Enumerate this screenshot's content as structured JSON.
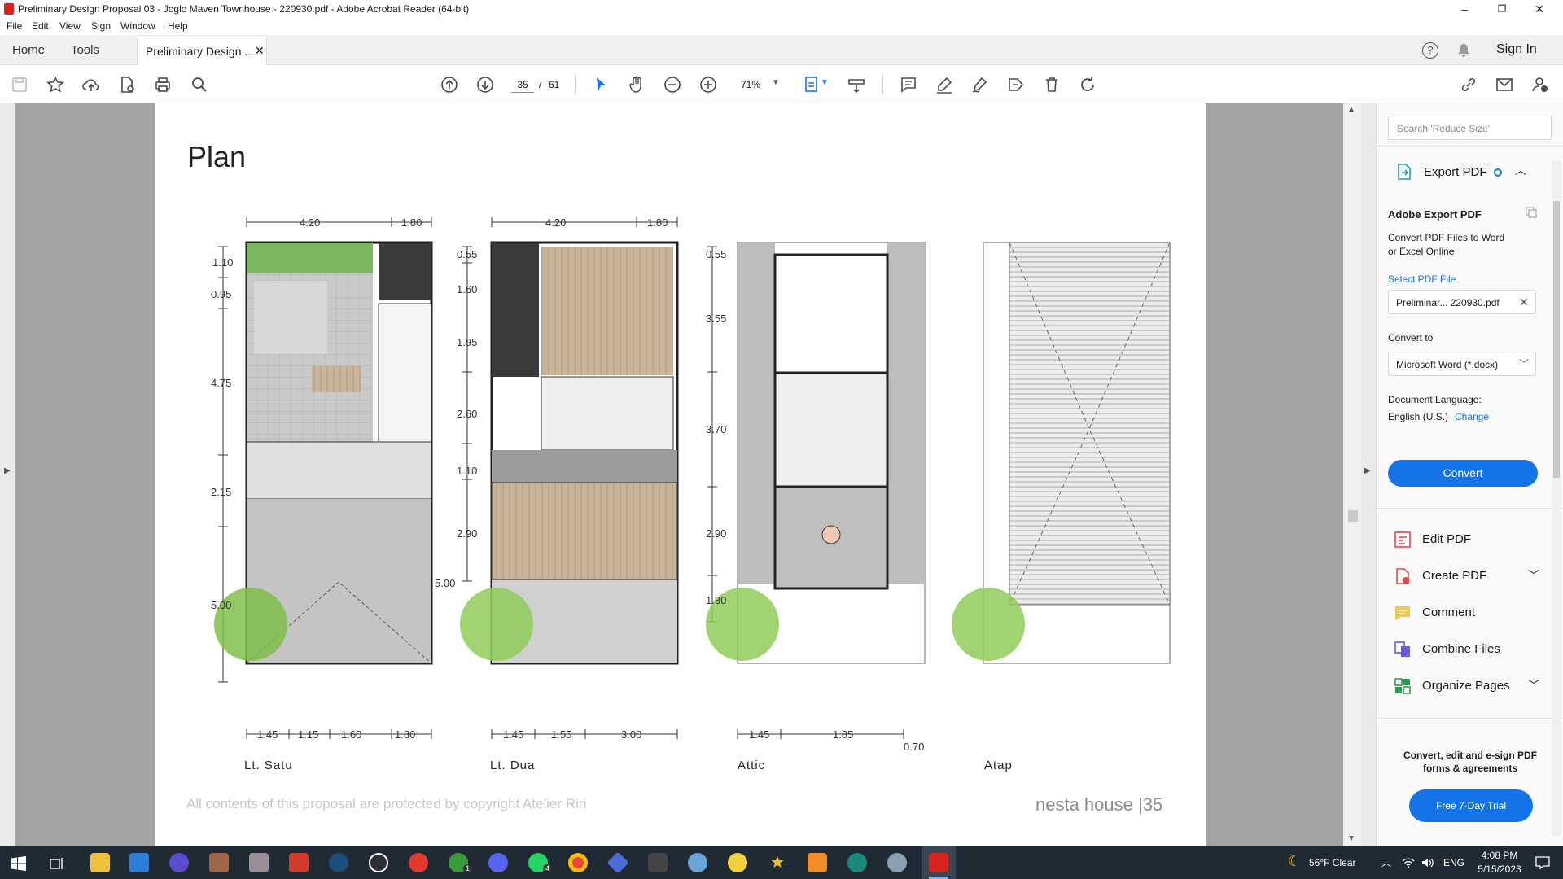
{
  "window": {
    "title": "Preliminary Design Proposal 03 - Joglo Maven Townhouse - 220930.pdf - Adobe Acrobat Reader (64-bit)",
    "minimize": "–",
    "maximize": "❐",
    "close": "✕"
  },
  "menu": [
    "File",
    "Edit",
    "View",
    "Sign",
    "Window",
    "Help"
  ],
  "tabs": {
    "home": "Home",
    "tools": "Tools",
    "document": "Preliminary Design ...",
    "close": "✕",
    "sign_in": "Sign In"
  },
  "toolbar": {
    "current_page": "35",
    "page_separator": "/",
    "total_pages": "61",
    "zoom": "71%"
  },
  "page": {
    "heading": "Plan",
    "footer_copyright": "All contents of this proposal are protected by copyright Atelier Riri",
    "footer_brand": "nesta house |35",
    "plans": [
      {
        "label": "Lt. Satu",
        "top_dims": [
          "4.20",
          "1.80"
        ],
        "bottom_dims": [
          "1.45",
          "1.15",
          "1.60",
          "1.80"
        ],
        "side_dims": [
          "1.10",
          "0.95",
          "4.75",
          "2.15",
          "5.00"
        ]
      },
      {
        "label": "Lt. Dua",
        "top_dims": [
          "4.20",
          "1.80"
        ],
        "bottom_dims": [
          "1.45",
          "1.55",
          "3.00"
        ],
        "side_dims": [
          "0.55",
          "1.60",
          "1.95",
          "2.60",
          "1.10",
          "2.90",
          "5.00"
        ]
      },
      {
        "label": "Attic",
        "top_dims": [],
        "bottom_dims": [
          "1.45",
          "1.85",
          "0.70"
        ],
        "side_dims": [
          "0.55",
          "3.55",
          "3.70",
          "2.90",
          "1.30"
        ]
      },
      {
        "label": "Atap",
        "top_dims": [],
        "bottom_dims": [],
        "side_dims": []
      }
    ]
  },
  "right_panel": {
    "search_placeholder": "Search 'Reduce Size'",
    "export_header": "Export PDF",
    "adobe_export_title": "Adobe Export PDF",
    "adobe_export_desc_1": "Convert PDF Files to Word",
    "adobe_export_desc_2": "or Excel Online",
    "select_pdf": "Select PDF File",
    "selected_file": "Preliminar... 220930.pdf",
    "convert_to_label": "Convert to",
    "convert_to_value": "Microsoft Word (*.docx)",
    "doc_lang_label": "Document Language:",
    "doc_lang_value": "English (U.S.)",
    "change": "Change",
    "convert_button": "Convert",
    "tools": [
      "Edit PDF",
      "Create PDF",
      "Comment",
      "Combine Files",
      "Organize Pages"
    ],
    "promo_1": "Convert, edit and e-sign PDF",
    "promo_2": "forms & agreements",
    "trial_button": "Free 7-Day Trial"
  },
  "taskbar": {
    "weather": "56°F  Clear",
    "lang": "ENG",
    "time": "4:08 PM",
    "date": "5/15/2023",
    "badge_whatsapp": "4",
    "badge_xbox": "1"
  },
  "colors": {
    "accent_blue": "#1473e6",
    "acrobat_red": "#d9231d",
    "taskbar_bg": "#1f2a34",
    "doc_bg": "#a3a3a3"
  }
}
